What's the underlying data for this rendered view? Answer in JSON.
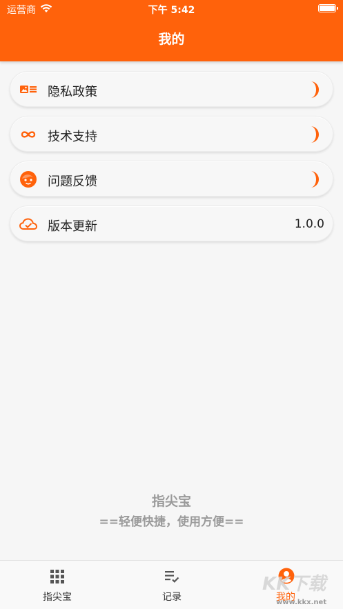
{
  "status_bar": {
    "carrier": "运营商",
    "time": "下午 5:42"
  },
  "header": {
    "title": "我的"
  },
  "menu": [
    {
      "label": "隐私政策",
      "icon": "id-card-icon"
    },
    {
      "label": "技术支持",
      "icon": "infinity-icon"
    },
    {
      "label": "问题反馈",
      "icon": "face-icon"
    },
    {
      "label": "版本更新",
      "icon": "cloud-check-icon",
      "value": "1.0.0"
    }
  ],
  "slogan": {
    "title": "指尖宝",
    "subtitle": "==轻便快捷，使用方便=="
  },
  "tabs": [
    {
      "label": "指尖宝",
      "icon": "grid-icon"
    },
    {
      "label": "记录",
      "icon": "list-check-icon"
    },
    {
      "label": "我的",
      "icon": "user-icon",
      "active": true
    }
  ],
  "watermark": {
    "brand": "KK下载",
    "url": "www.kkx.net"
  },
  "colors": {
    "accent": "#ff620b",
    "background": "#f6f6f6",
    "muted_text": "#9a9a9a"
  }
}
